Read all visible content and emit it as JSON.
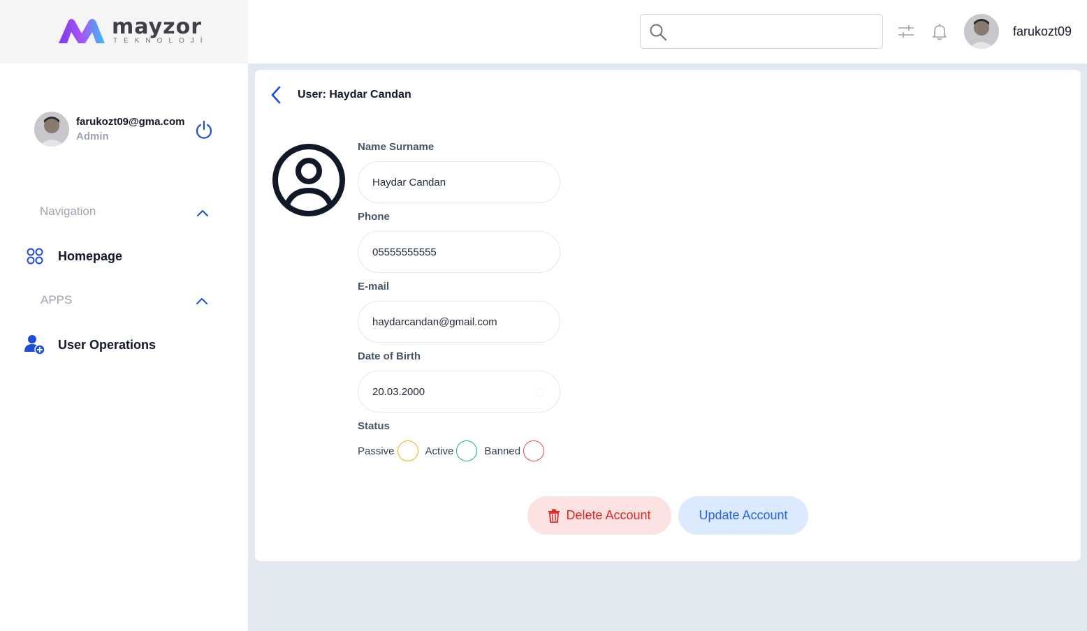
{
  "brand": {
    "name": "mayzor",
    "subtitle": "TEKNOLOJİ"
  },
  "sidebar": {
    "profile": {
      "email": "farukozt09@gma.com",
      "role": "Admin"
    },
    "sections": [
      {
        "label": "Navigation",
        "items": [
          {
            "label": "Homepage",
            "icon": "grid-icon"
          }
        ]
      },
      {
        "label": "APPS",
        "items": [
          {
            "label": "User Operations",
            "icon": "user-add-icon"
          }
        ]
      }
    ]
  },
  "topbar": {
    "search": {
      "placeholder": "",
      "value": ""
    },
    "username": "farukozt09"
  },
  "main": {
    "title": "User: Haydar Candan",
    "fields": {
      "name": {
        "label": "Name Surname",
        "value": "Haydar Candan"
      },
      "phone": {
        "label": "Phone",
        "value": "05555555555"
      },
      "email": {
        "label": "E-mail",
        "value": "haydarcandan@gmail.com"
      },
      "dob": {
        "label": "Date of Birth",
        "value": "20.03.2000"
      }
    },
    "status": {
      "label": "Status",
      "options": [
        {
          "label": "Passive",
          "color": "#eab308"
        },
        {
          "label": "Active",
          "color": "#10b981"
        },
        {
          "label": "Banned",
          "color": "#ef4444"
        }
      ]
    },
    "buttons": {
      "delete": "Delete Account",
      "update": "Update Account"
    }
  },
  "colors": {
    "accent": "#2563eb",
    "danger": "#dc2626",
    "background": "#e2e8f0"
  }
}
